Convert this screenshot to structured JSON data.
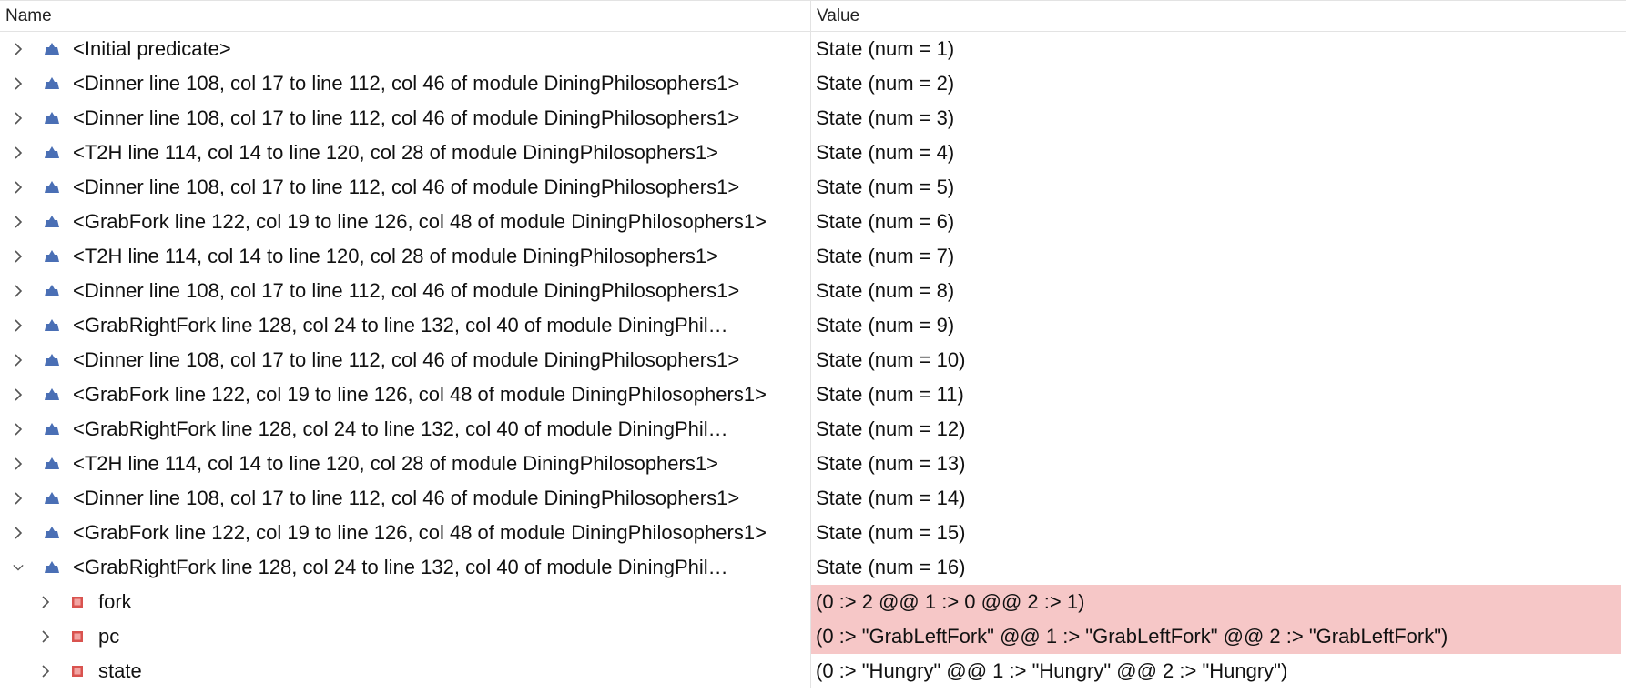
{
  "header": {
    "name": "Name",
    "value": "Value"
  },
  "rows": [
    {
      "name": "<Initial predicate>",
      "value": "State (num = 1)",
      "expanded": false
    },
    {
      "name": "<Dinner line 108, col 17 to line 112, col 46 of module DiningPhilosophers1>",
      "value": "State (num = 2)",
      "expanded": false
    },
    {
      "name": "<Dinner line 108, col 17 to line 112, col 46 of module DiningPhilosophers1>",
      "value": "State (num = 3)",
      "expanded": false
    },
    {
      "name": "<T2H line 114, col 14 to line 120, col 28 of module DiningPhilosophers1>",
      "value": "State (num = 4)",
      "expanded": false
    },
    {
      "name": "<Dinner line 108, col 17 to line 112, col 46 of module DiningPhilosophers1>",
      "value": "State (num = 5)",
      "expanded": false
    },
    {
      "name": "<GrabFork line 122, col 19 to line 126, col 48 of module DiningPhilosophers1>",
      "value": "State (num = 6)",
      "expanded": false
    },
    {
      "name": "<T2H line 114, col 14 to line 120, col 28 of module DiningPhilosophers1>",
      "value": "State (num = 7)",
      "expanded": false
    },
    {
      "name": "<Dinner line 108, col 17 to line 112, col 46 of module DiningPhilosophers1>",
      "value": "State (num = 8)",
      "expanded": false
    },
    {
      "name": "<GrabRightFork line 128, col 24 to line 132, col 40 of module DiningPhil…",
      "value": "State (num = 9)",
      "expanded": false
    },
    {
      "name": "<Dinner line 108, col 17 to line 112, col 46 of module DiningPhilosophers1>",
      "value": "State (num = 10)",
      "expanded": false
    },
    {
      "name": "<GrabFork line 122, col 19 to line 126, col 48 of module DiningPhilosophers1>",
      "value": "State (num = 11)",
      "expanded": false
    },
    {
      "name": "<GrabRightFork line 128, col 24 to line 132, col 40 of module DiningPhil…",
      "value": "State (num = 12)",
      "expanded": false
    },
    {
      "name": "<T2H line 114, col 14 to line 120, col 28 of module DiningPhilosophers1>",
      "value": "State (num = 13)",
      "expanded": false
    },
    {
      "name": "<Dinner line 108, col 17 to line 112, col 46 of module DiningPhilosophers1>",
      "value": "State (num = 14)",
      "expanded": false
    },
    {
      "name": "<GrabFork line 122, col 19 to line 126, col 48 of module DiningPhilosophers1>",
      "value": "State (num = 15)",
      "expanded": false
    },
    {
      "name": "<GrabRightFork line 128, col 24 to line 132, col 40 of module DiningPhil…",
      "value": "State (num = 16)",
      "expanded": true
    }
  ],
  "variables": [
    {
      "name": "fork",
      "value": "(0 :> 2 @@ 1 :> 0 @@ 2 :> 1)",
      "changed": true
    },
    {
      "name": "pc",
      "value": "(0 :> \"GrabLeftFork\" @@ 1 :> \"GrabLeftFork\" @@ 2 :> \"GrabLeftFork\")",
      "changed": true
    },
    {
      "name": "state",
      "value": "(0 :> \"Hungry\" @@ 1 :> \"Hungry\" @@ 2 :> \"Hungry\")",
      "changed": false
    }
  ],
  "colors": {
    "changed_bg": "#f6c7c7",
    "step_icon": "#4a6fb5",
    "var_icon": "#d9534f"
  }
}
